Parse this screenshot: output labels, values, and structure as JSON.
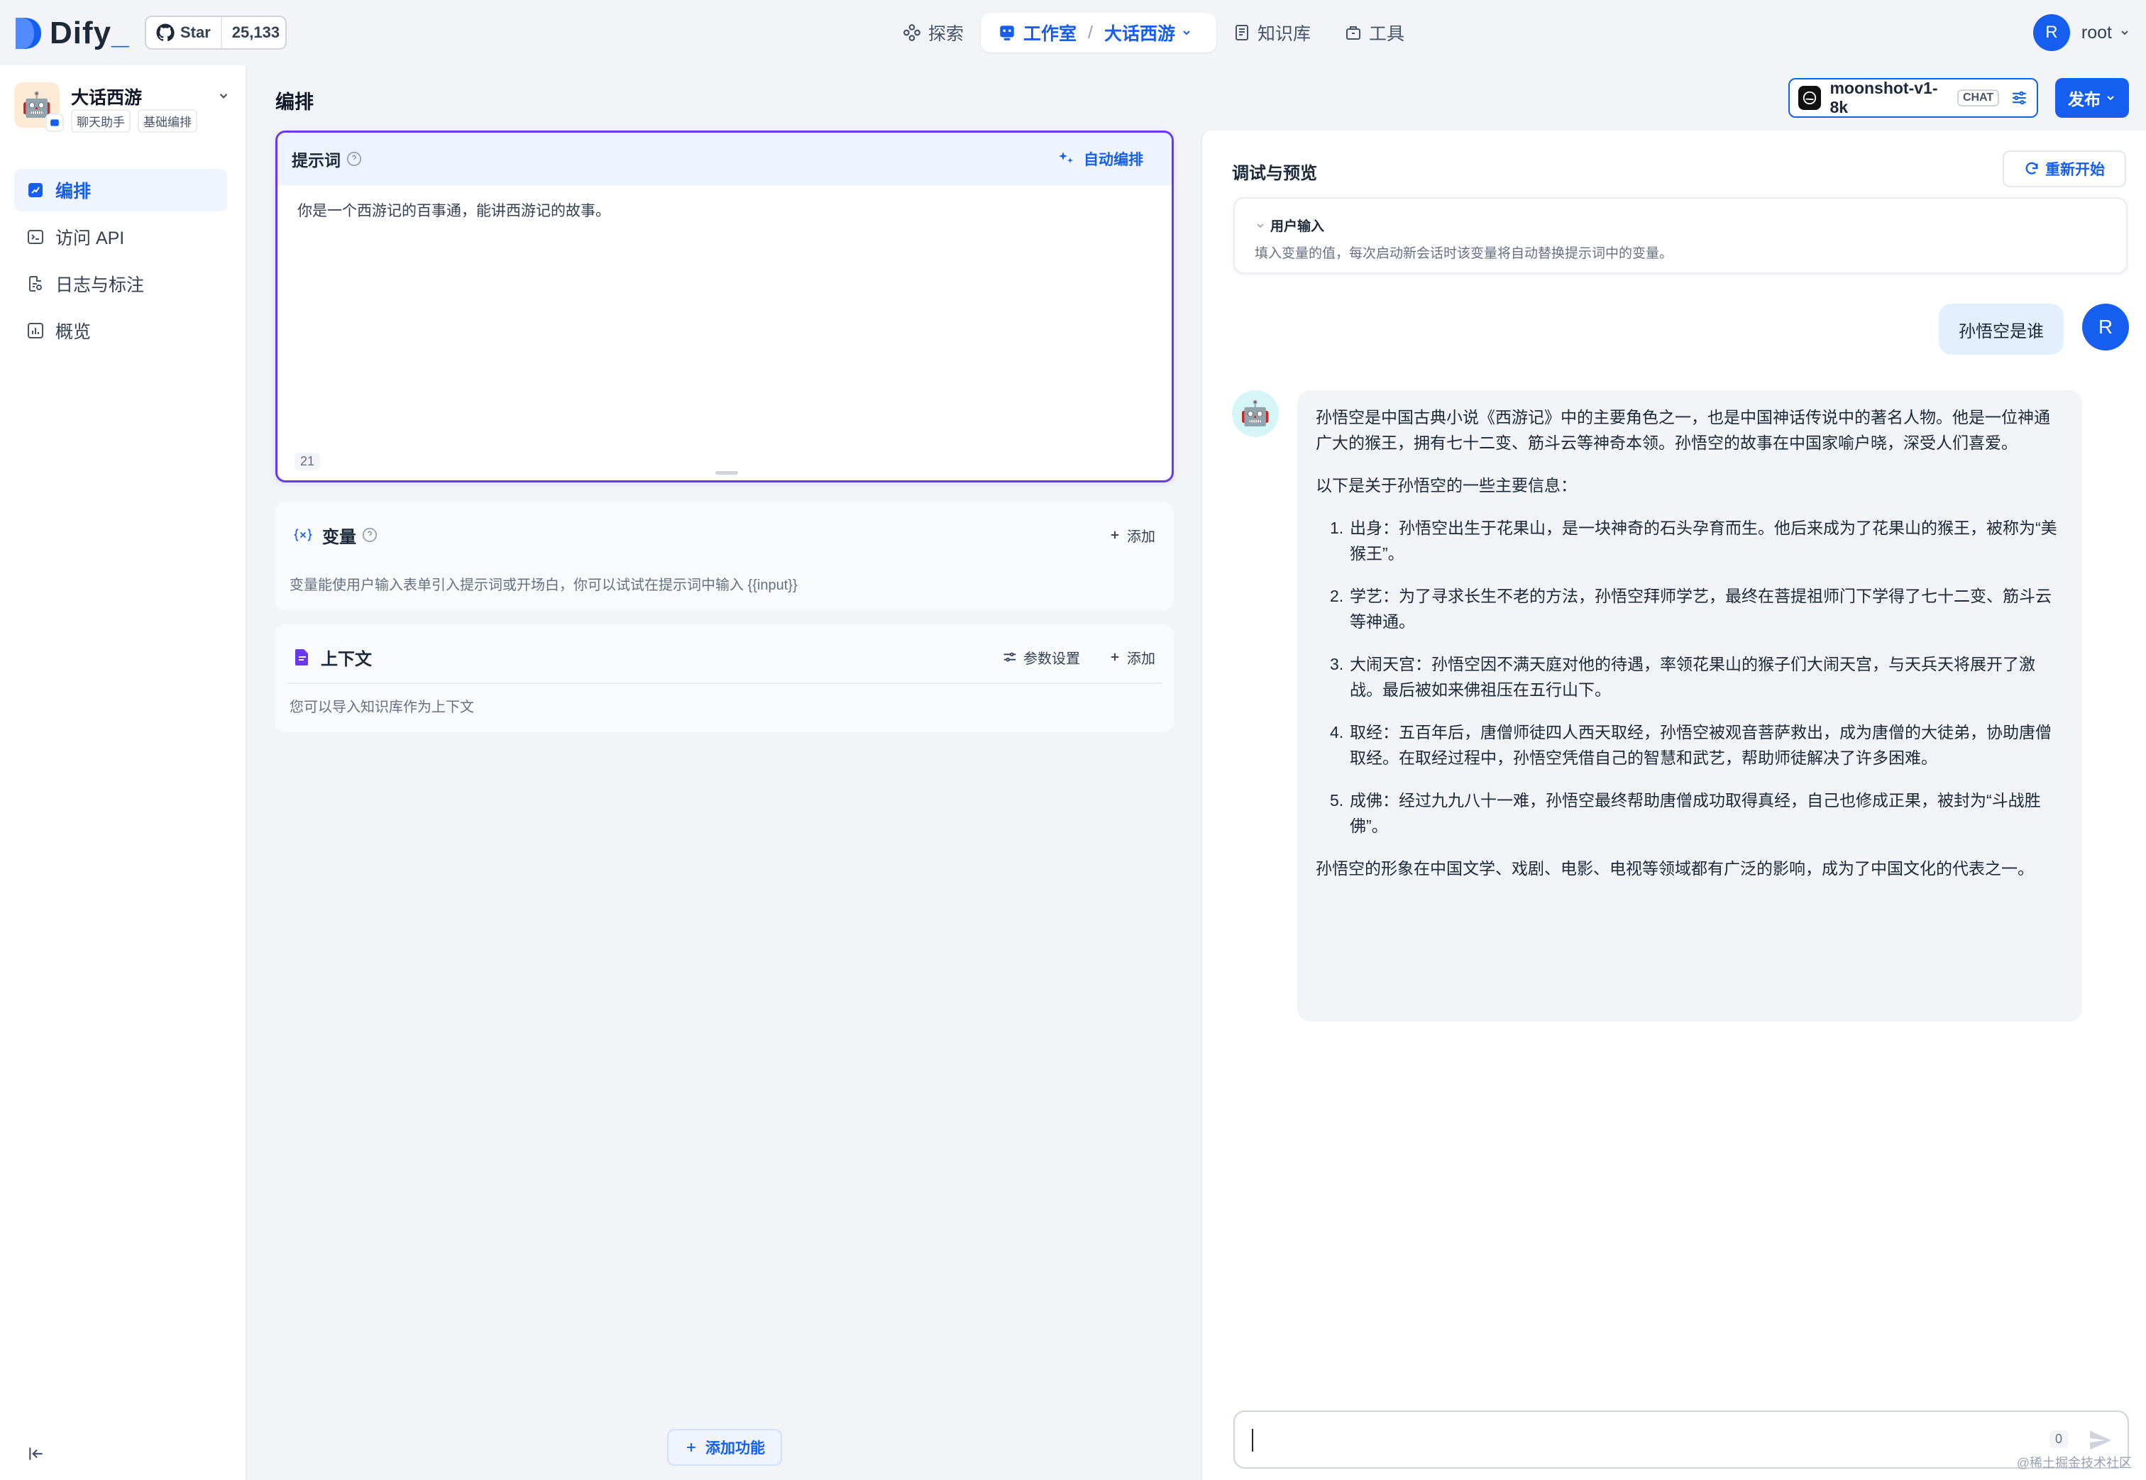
{
  "brand": {
    "name": "Dify",
    "accent": "#155eef"
  },
  "github": {
    "star_label": "Star",
    "star_count": "25,133"
  },
  "nav": {
    "explore": "探索",
    "studio": "工作室",
    "separator": "/",
    "current_app": "大话西游",
    "knowledge": "知识库",
    "tools": "工具"
  },
  "user": {
    "initial": "R",
    "name": "root"
  },
  "app": {
    "name": "大话西游",
    "tags": [
      "聊天助手",
      "基础编排"
    ],
    "icon": "robot-icon"
  },
  "sidebar": {
    "items": [
      {
        "label": "编排",
        "icon": "orchestrate-icon",
        "active": true
      },
      {
        "label": "访问 API",
        "icon": "terminal-icon",
        "active": false
      },
      {
        "label": "日志与标注",
        "icon": "logs-icon",
        "active": false
      },
      {
        "label": "概览",
        "icon": "chart-icon",
        "active": false
      }
    ]
  },
  "header": {
    "title": "编排",
    "model_name": "moonshot-v1-8k",
    "model_mode": "CHAT",
    "publish_label": "发布"
  },
  "prompt": {
    "label": "提示词",
    "auto_label": "自动编排",
    "text": "你是一个西游记的百事通，能讲西游记的故事。",
    "char_count": "21"
  },
  "variables": {
    "label": "变量",
    "add_label": "添加",
    "description": "变量能使用户输入表单引入提示词或开场白，你可以试试在提示词中输入 {{input}}"
  },
  "context": {
    "label": "上下文",
    "params_label": "参数设置",
    "add_label": "添加",
    "description": "您可以导入知识库作为上下文"
  },
  "add_feature_label": "添加功能",
  "debug": {
    "title": "调试与预览",
    "restart_label": "重新开始",
    "user_input_title": "用户输入",
    "user_input_desc": "填入变量的值，每次启动新会话时该变量将自动替换提示词中的变量。"
  },
  "chat": {
    "question": "孙悟空是谁",
    "answer_intro": "孙悟空是中国古典小说《西游记》中的主要角色之一，也是中国神话传说中的著名人物。他是一位神通广大的猴王，拥有七十二变、筋斗云等神奇本领。孙悟空的故事在中国家喻户晓，深受人们喜爱。",
    "answer_lead": "以下是关于孙悟空的一些主要信息：",
    "answer_items": [
      {
        "num": "1.",
        "text": "出身：孙悟空出生于花果山，是一块神奇的石头孕育而生。他后来成为了花果山的猴王，被称为“美猴王”。"
      },
      {
        "num": "2.",
        "text": "学艺：为了寻求长生不老的方法，孙悟空拜师学艺，最终在菩提祖师门下学得了七十二变、筋斗云等神通。"
      },
      {
        "num": "3.",
        "text": "大闹天宫：孙悟空因不满天庭对他的待遇，率领花果山的猴子们大闹天宫，与天兵天将展开了激战。最后被如来佛祖压在五行山下。"
      },
      {
        "num": "4.",
        "text": "取经：五百年后，唐僧师徒四人西天取经，孙悟空被观音菩萨救出，成为唐僧的大徒弟，协助唐僧取经。在取经过程中，孙悟空凭借自己的智慧和武艺，帮助师徒解决了许多困难。"
      },
      {
        "num": "5.",
        "text": "成佛：经过九九八十一难，孙悟空最终帮助唐僧成功取得真经，自己也修成正果，被封为“斗战胜佛”。"
      }
    ],
    "answer_outro": "孙悟空的形象在中国文学、戏剧、电影、电视等领域都有广泛的影响，成为了中国文化的代表之一。",
    "input_count": "0"
  },
  "watermark": "@稀土掘金技术社区"
}
